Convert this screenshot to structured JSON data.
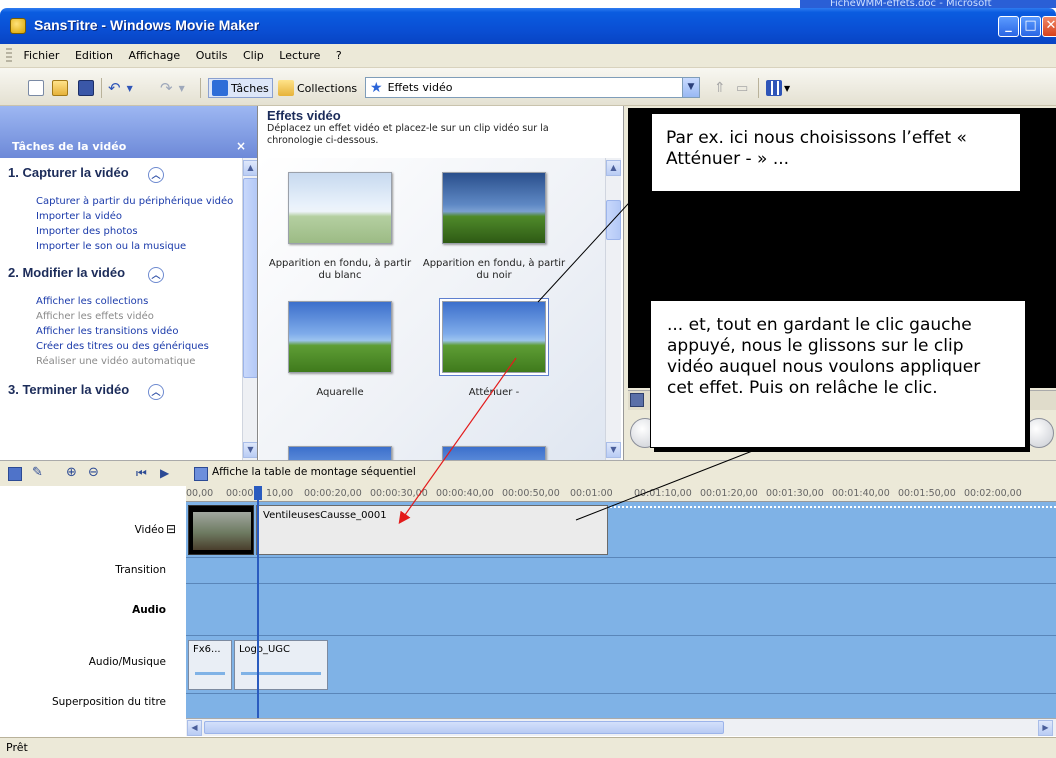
{
  "window": {
    "title": "SansTitre - Windows Movie Maker",
    "behind_title": "FicheWMM-effets.doc - Microsoft"
  },
  "menu": [
    "Fichier",
    "Edition",
    "Affichage",
    "Outils",
    "Clip",
    "Lecture",
    "?"
  ],
  "toolbar": {
    "tasks_label": "Tâches",
    "collections_label": "Collections",
    "collection_select": "Effets vidéo"
  },
  "tasks": {
    "header": "Tâches de la vidéo",
    "close": "×",
    "sections": [
      {
        "title": "1. Capturer la vidéo",
        "links": [
          {
            "label": "Capturer à partir du périphérique vidéo",
            "enabled": true
          },
          {
            "label": "Importer la vidéo",
            "enabled": true
          },
          {
            "label": "Importer des photos",
            "enabled": true
          },
          {
            "label": "Importer le son ou la musique",
            "enabled": true
          }
        ]
      },
      {
        "title": "2. Modifier la vidéo",
        "links": [
          {
            "label": "Afficher les collections",
            "enabled": true
          },
          {
            "label": "Afficher les effets vidéo",
            "enabled": false
          },
          {
            "label": "Afficher les transitions vidéo",
            "enabled": true
          },
          {
            "label": "Créer des titres ou des génériques",
            "enabled": true
          },
          {
            "label": "Réaliser une vidéo automatique",
            "enabled": false
          }
        ]
      },
      {
        "title": "3. Terminer la vidéo",
        "links": []
      }
    ]
  },
  "effects": {
    "title": "Effets vidéo",
    "description": "Déplacez un effet vidéo et placez-le sur un clip vidéo sur la chronologie ci-dessous.",
    "items": [
      {
        "label": "Apparition en fondu, à partir du blanc"
      },
      {
        "label": "Apparition en fondu, à partir du noir"
      },
      {
        "label": "Aquarelle"
      },
      {
        "label": "Atténuer -"
      }
    ]
  },
  "callouts": {
    "first": "Par ex. ici nous choisissons l’effet « Atténuer - » ...",
    "second": "... et, tout en gardant le clic gauche appuyé, nous le glissons sur le clip vidéo auquel nous voulons appliquer cet effet. Puis on relâche le clic."
  },
  "timeline": {
    "storyboard_label": "Affiche la table de montage séquentiel",
    "ruler": [
      "00,00",
      "00:00",
      "10,00",
      "00:00:20,00",
      "00:00:30,00",
      "00:00:40,00",
      "00:00:50,00",
      "00:01:00",
      "00:01:10,00",
      "00:01:20,00",
      "00:01:30,00",
      "00:01:40,00",
      "00:01:50,00",
      "00:02:00,00"
    ],
    "tracks": {
      "video": "Vidéo",
      "video_toggle": "⊟",
      "transition": "Transition",
      "audio": "Audio",
      "music": "Audio/Musique",
      "title_overlay": "Superposition du titre"
    },
    "video_clip": "VentileusesCausse_0001",
    "audio_clips": [
      "Fx6...",
      "Logo_UGC"
    ]
  },
  "status": "Prêt",
  "colors": {
    "titlebar": "#0a4fd4",
    "task_pane": "#7a96df",
    "timeline_lane": "#7fb2e6",
    "arrow": "#e31b1b"
  }
}
